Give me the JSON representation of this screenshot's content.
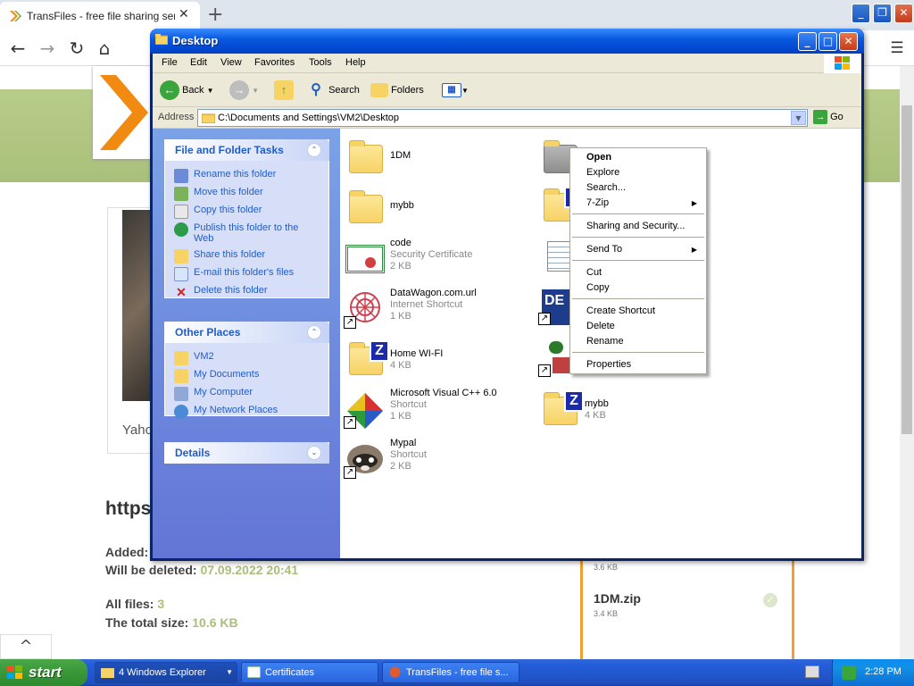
{
  "browser": {
    "tab_title": "TransFiles - free file sharing service",
    "close_tab": "✕",
    "new_tab": "+",
    "back": "←",
    "forward": "→",
    "reload": "↻",
    "home": "⌂",
    "menu": "☰",
    "window_min": "_",
    "window_max": "❐",
    "window_close": "✕"
  },
  "webpage": {
    "photo_caption": "Yaho",
    "heading": "https",
    "added_label": "Added:",
    "deleted_label": "Will be deleted:",
    "deleted_value": "07.09.2022 20:41",
    "all_files_label": "All files:",
    "all_files_value": "3",
    "total_size_label": "The total size:",
    "total_size_value": "10.6 KB",
    "card_size_top": "3.6 KB",
    "card_name": "1DM.zip",
    "card_size": "3.4 KB",
    "scroll_up": "^"
  },
  "explorer": {
    "title": "Desktop",
    "menu": [
      "File",
      "Edit",
      "View",
      "Favorites",
      "Tools",
      "Help"
    ],
    "toolbar": {
      "back": "Back",
      "search": "Search",
      "folders": "Folders"
    },
    "address_label": "Address",
    "address_value": "C:\\Documents and Settings\\VM2\\Desktop",
    "go_label": "Go",
    "file_tasks": {
      "title": "File and Folder Tasks",
      "items": [
        "Rename this folder",
        "Move this folder",
        "Copy this folder",
        "Publish this folder to the Web",
        "Share this folder",
        "E-mail this folder's files",
        "Delete this folder"
      ]
    },
    "other_places": {
      "title": "Other Places",
      "items": [
        "VM2",
        "My Documents",
        "My Computer",
        "My Network Places"
      ]
    },
    "details_title": "Details",
    "files": [
      {
        "name": "1DM",
        "line1": "",
        "line2": ""
      },
      {
        "name": "mybb",
        "line1": "",
        "line2": ""
      },
      {
        "name": "code",
        "line1": "Security Certificate",
        "line2": "2 KB"
      },
      {
        "name": "DataWagon.com.url",
        "line1": "Internet Shortcut",
        "line2": "1 KB"
      },
      {
        "name": "Home WI-FI",
        "line1": "4 KB",
        "line2": ""
      },
      {
        "name": "Microsoft Visual C++ 6.0",
        "line1": "Shortcut",
        "line2": "1 KB"
      },
      {
        "name": "Mypal",
        "line1": "Shortcut",
        "line2": "2 KB"
      },
      {
        "name": "mybb",
        "line1": "4 KB",
        "line2": ""
      }
    ]
  },
  "context_menu": {
    "items": [
      "Open",
      "Explore",
      "Search...",
      "7-Zip",
      "Sharing and Security...",
      "Send To",
      "Cut",
      "Copy",
      "Create Shortcut",
      "Delete",
      "Rename",
      "Properties"
    ]
  },
  "taskbar": {
    "start": "start",
    "buttons": [
      "4 Windows Explorer",
      "Certificates",
      "TransFiles - free file s..."
    ],
    "clock": "2:28 PM"
  },
  "colors": {
    "xp_blue": "#0a5ae0",
    "accent_green": "#a9be7a",
    "orange": "#f0a030"
  }
}
